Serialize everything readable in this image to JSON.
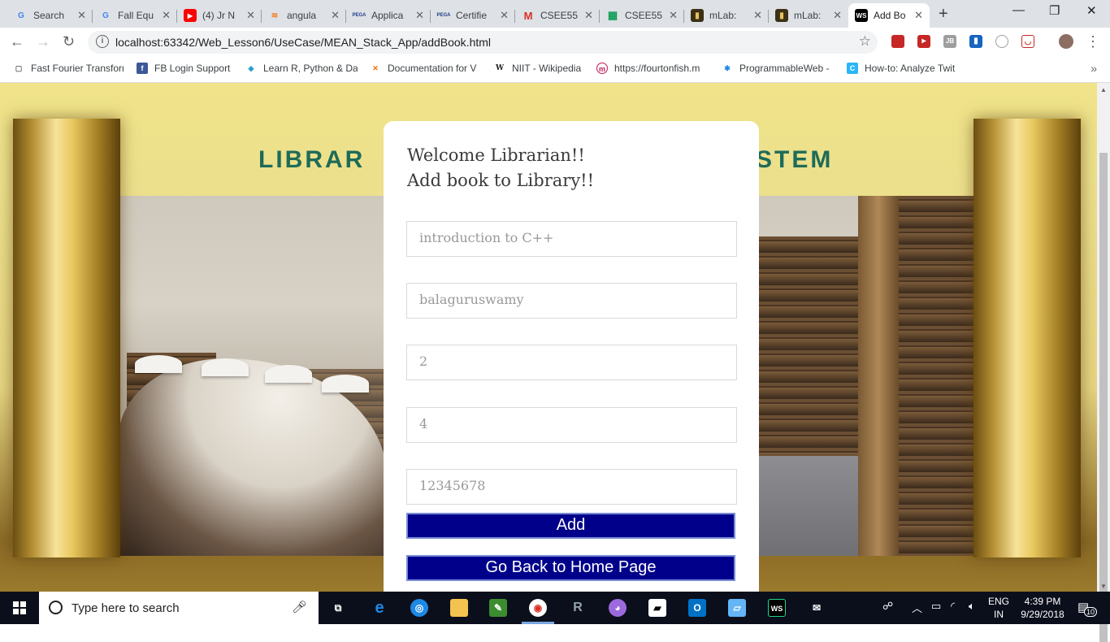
{
  "browser": {
    "tabs": [
      {
        "title": "Search",
        "favicon": "G",
        "color": "#4285f4"
      },
      {
        "title": "Fall Equ",
        "favicon": "G",
        "color": "#4285f4"
      },
      {
        "title": "(4) Jr N",
        "favicon": "▶",
        "color": "#ff0000"
      },
      {
        "title": "angula",
        "favicon": "≋",
        "color": "#f48024"
      },
      {
        "title": "Applica",
        "favicon": "PEGA",
        "color": "#1f3c88"
      },
      {
        "title": "Certifie",
        "favicon": "PEGA",
        "color": "#1f3c88"
      },
      {
        "title": "CSEE55",
        "favicon": "M",
        "color": "#d93025"
      },
      {
        "title": "CSEE55",
        "favicon": "▦",
        "color": "#0f9d58"
      },
      {
        "title": "mLab: ",
        "favicon": "▮",
        "color": "#6b4f14"
      },
      {
        "title": "mLab: ",
        "favicon": "▮",
        "color": "#6b4f14"
      },
      {
        "title": "Add Bo",
        "favicon": "WS",
        "color": "#000000"
      }
    ],
    "address": "localhost:63342/Web_Lesson6/UseCase/MEAN_Stack_App/addBook.html",
    "bookmarks": [
      {
        "label": "Fast Fourier Transforn",
        "icon": "▢",
        "color": "#5f6368"
      },
      {
        "label": "FB Login Support",
        "icon": "f",
        "color": "#3b5998"
      },
      {
        "label": "Learn R, Python & Da",
        "icon": "◈",
        "color": "#1a9ac9"
      },
      {
        "label": "Documentation for V",
        "icon": "✕",
        "color": "#e8710a"
      },
      {
        "label": "NIIT - Wikipedia",
        "icon": "W",
        "color": "#202124"
      },
      {
        "label": "https://fourtonfish.m",
        "icon": "m",
        "color": "#c2185b"
      },
      {
        "label": "ProgrammableWeb -",
        "icon": "✱",
        "color": "#1e88e5"
      },
      {
        "label": "How-to: Analyze Twit",
        "icon": "C",
        "color": "#29b6f6"
      }
    ]
  },
  "page": {
    "header_left": "LIBRAR",
    "header_right": "STEM",
    "welcome_line1": "Welcome Librarian!!",
    "welcome_line2": "Add book to Library!!",
    "fields": [
      {
        "name": "book-title-field",
        "placeholder": "introduction to C++"
      },
      {
        "name": "author-field",
        "placeholder": "balaguruswamy"
      },
      {
        "name": "edition-field",
        "placeholder": "2"
      },
      {
        "name": "copies-field",
        "placeholder": "4"
      },
      {
        "name": "isbn-field",
        "placeholder": "12345678"
      }
    ],
    "add_label": "Add",
    "back_label": "Go Back to Home Page"
  },
  "taskbar": {
    "search_placeholder": "Type here to search",
    "lang_line1": "ENG",
    "lang_line2": "IN",
    "time": "4:39 PM",
    "date": "9/29/2018",
    "notification_count": "10"
  }
}
